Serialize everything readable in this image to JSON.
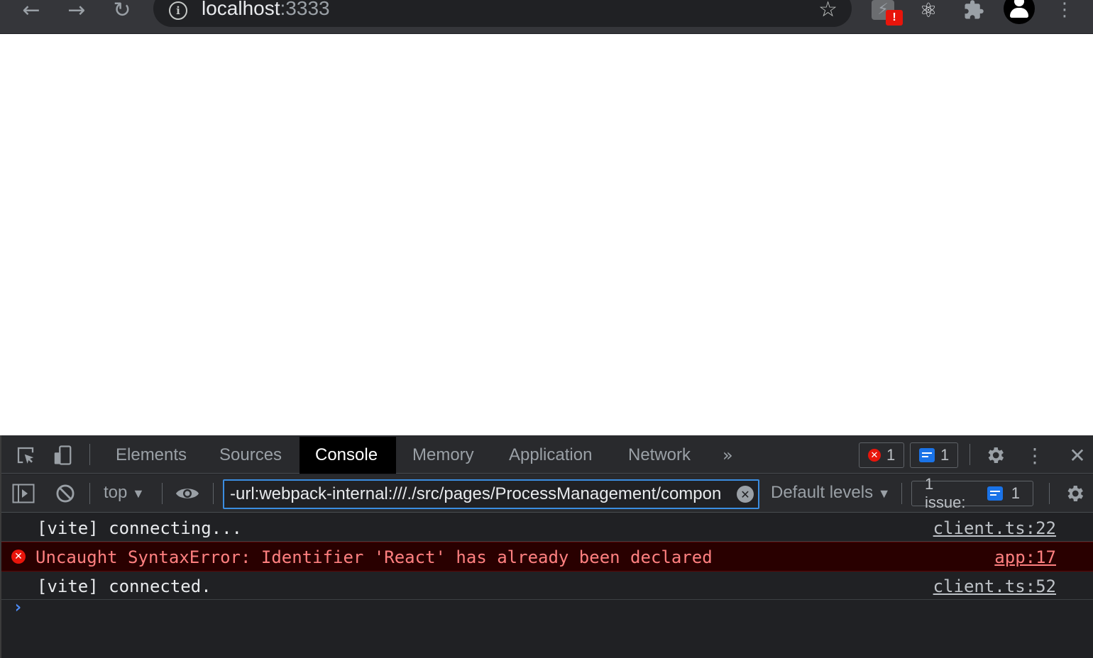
{
  "browser": {
    "url_host": "localhost",
    "url_port": ":3333",
    "back_icon": "arrow-left",
    "forward_icon": "arrow-right",
    "reload_icon": "reload",
    "bookmark_icon": "star-outline",
    "extensions": [
      {
        "name": "bolt-extension",
        "badge": "!"
      },
      {
        "name": "react-devtools"
      },
      {
        "name": "extensions-puzzle"
      },
      {
        "name": "profile-avatar"
      }
    ]
  },
  "devtools": {
    "tabs": [
      {
        "label": "Elements",
        "active": false
      },
      {
        "label": "Sources",
        "active": false
      },
      {
        "label": "Console",
        "active": true
      },
      {
        "label": "Memory",
        "active": false
      },
      {
        "label": "Application",
        "active": false
      },
      {
        "label": "Network",
        "active": false
      }
    ],
    "more_tabs": "»",
    "error_count": "1",
    "message_count": "1",
    "toolbar": {
      "context": "top",
      "filter_value": "-url:webpack-internal:///./src/pages/ProcessManagement/compon",
      "levels": "Default levels",
      "issues_label": "1 issue:",
      "issues_count": "1"
    },
    "messages": [
      {
        "type": "log",
        "text": "[vite] connecting...",
        "source": "client.ts:22"
      },
      {
        "type": "error",
        "text": "Uncaught SyntaxError: Identifier 'React' has already been declared",
        "source": "app:17"
      },
      {
        "type": "log",
        "text": "[vite] connected.",
        "source": "client.ts:52"
      }
    ],
    "prompt": "›"
  },
  "colors": {
    "active_tab_bg": "#000000",
    "error_bg": "#290000",
    "error_text": "#ff8080",
    "filter_border": "#3b8de0",
    "accent_blue": "#1a73e8",
    "error_red": "#e8150b"
  }
}
